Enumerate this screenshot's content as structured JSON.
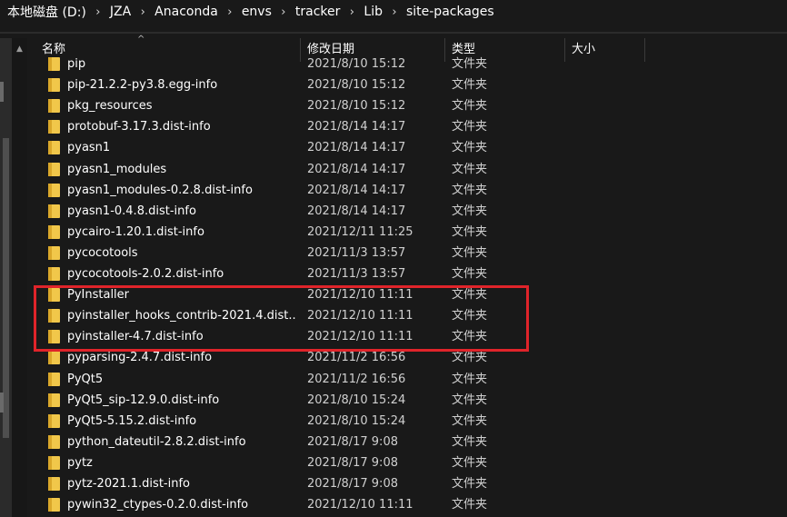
{
  "breadcrumb": [
    "本地磁盘 (D:)",
    "JZA",
    "Anaconda",
    "envs",
    "tracker",
    "Lib",
    "site-packages"
  ],
  "breadcrumb_separator": "›",
  "columns": {
    "name": "名称",
    "date": "修改日期",
    "type": "类型",
    "size": "大小"
  },
  "sort_caret": "^",
  "scroll_up_arrow": "▲",
  "rows": [
    {
      "name": "pip",
      "date": "2021/8/10 15:12",
      "type": "文件夹"
    },
    {
      "name": "pip-21.2.2-py3.8.egg-info",
      "date": "2021/8/10 15:12",
      "type": "文件夹"
    },
    {
      "name": "pkg_resources",
      "date": "2021/8/10 15:12",
      "type": "文件夹"
    },
    {
      "name": "protobuf-3.17.3.dist-info",
      "date": "2021/8/14 14:17",
      "type": "文件夹"
    },
    {
      "name": "pyasn1",
      "date": "2021/8/14 14:17",
      "type": "文件夹"
    },
    {
      "name": "pyasn1_modules",
      "date": "2021/8/14 14:17",
      "type": "文件夹"
    },
    {
      "name": "pyasn1_modules-0.2.8.dist-info",
      "date": "2021/8/14 14:17",
      "type": "文件夹"
    },
    {
      "name": "pyasn1-0.4.8.dist-info",
      "date": "2021/8/14 14:17",
      "type": "文件夹"
    },
    {
      "name": "pycairo-1.20.1.dist-info",
      "date": "2021/12/11 11:25",
      "type": "文件夹"
    },
    {
      "name": "pycocotools",
      "date": "2021/11/3 13:57",
      "type": "文件夹"
    },
    {
      "name": "pycocotools-2.0.2.dist-info",
      "date": "2021/11/3 13:57",
      "type": "文件夹"
    },
    {
      "name": "PyInstaller",
      "date": "2021/12/10 11:11",
      "type": "文件夹"
    },
    {
      "name": "pyinstaller_hooks_contrib-2021.4.dist...",
      "date": "2021/12/10 11:11",
      "type": "文件夹"
    },
    {
      "name": "pyinstaller-4.7.dist-info",
      "date": "2021/12/10 11:11",
      "type": "文件夹"
    },
    {
      "name": "pyparsing-2.4.7.dist-info",
      "date": "2021/11/2 16:56",
      "type": "文件夹"
    },
    {
      "name": "PyQt5",
      "date": "2021/11/2 16:56",
      "type": "文件夹"
    },
    {
      "name": "PyQt5_sip-12.9.0.dist-info",
      "date": "2021/8/10 15:24",
      "type": "文件夹"
    },
    {
      "name": "PyQt5-5.15.2.dist-info",
      "date": "2021/8/10 15:24",
      "type": "文件夹"
    },
    {
      "name": "python_dateutil-2.8.2.dist-info",
      "date": "2021/8/17 9:08",
      "type": "文件夹"
    },
    {
      "name": "pytz",
      "date": "2021/8/17 9:08",
      "type": "文件夹"
    },
    {
      "name": "pytz-2021.1.dist-info",
      "date": "2021/8/17 9:08",
      "type": "文件夹"
    },
    {
      "name": "pywin32_ctypes-0.2.0.dist-info",
      "date": "2021/12/10 11:11",
      "type": "文件夹"
    }
  ],
  "colors": {
    "background": "#191919",
    "folder": "#f1c74a",
    "highlight": "#e0242a"
  },
  "icons": {
    "folder": "folder-icon"
  }
}
